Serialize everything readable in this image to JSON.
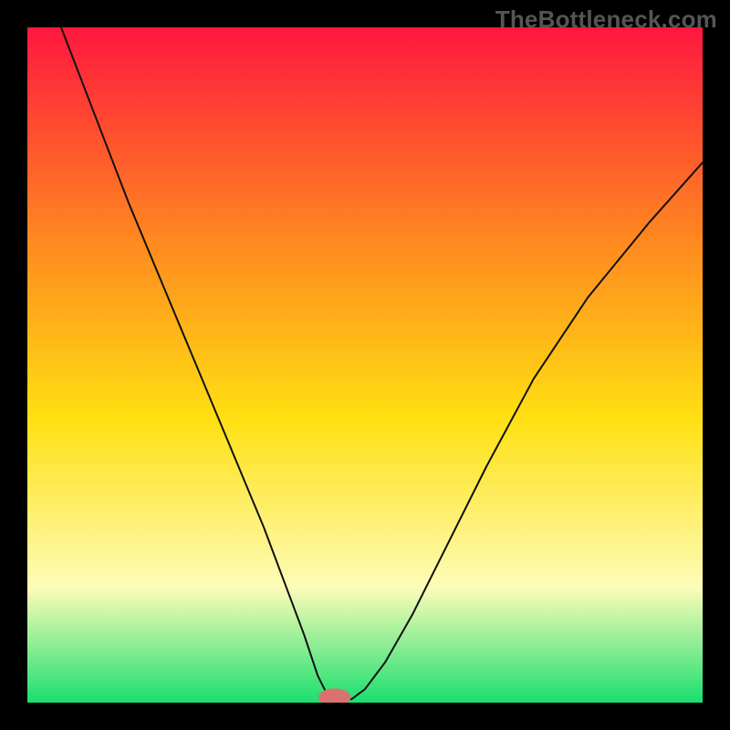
{
  "watermark": "TheBottleneck.com",
  "chart_data": {
    "type": "line",
    "title": "",
    "xlabel": "",
    "ylabel": "",
    "xlim": [
      0,
      100
    ],
    "ylim": [
      0,
      100
    ],
    "grid": false,
    "legend": false,
    "annotations": [],
    "gradient_colors": {
      "top": "#ff173f",
      "upper_mid": "#ff8a1f",
      "mid": "#ffe012",
      "lower_mid": "#fdfcb8",
      "bottom": "#1adf6f"
    },
    "marker": {
      "x": 45.5,
      "y": 0.8,
      "color": "#d9726e",
      "rx": 2.4,
      "ry": 1.3
    },
    "series": [
      {
        "name": "curve",
        "color": "#111111",
        "stroke_width": 2,
        "x": [
          5,
          10,
          15,
          20,
          25,
          30,
          35,
          38,
          41,
          43,
          44.5,
          46,
          48,
          50,
          53,
          57,
          62,
          68,
          75,
          83,
          92,
          100
        ],
        "y": [
          100,
          87,
          74,
          62,
          50,
          38,
          26,
          18,
          10,
          4,
          1,
          0.5,
          0.5,
          2,
          6,
          13,
          23,
          35,
          48,
          60,
          71,
          80
        ]
      }
    ]
  }
}
